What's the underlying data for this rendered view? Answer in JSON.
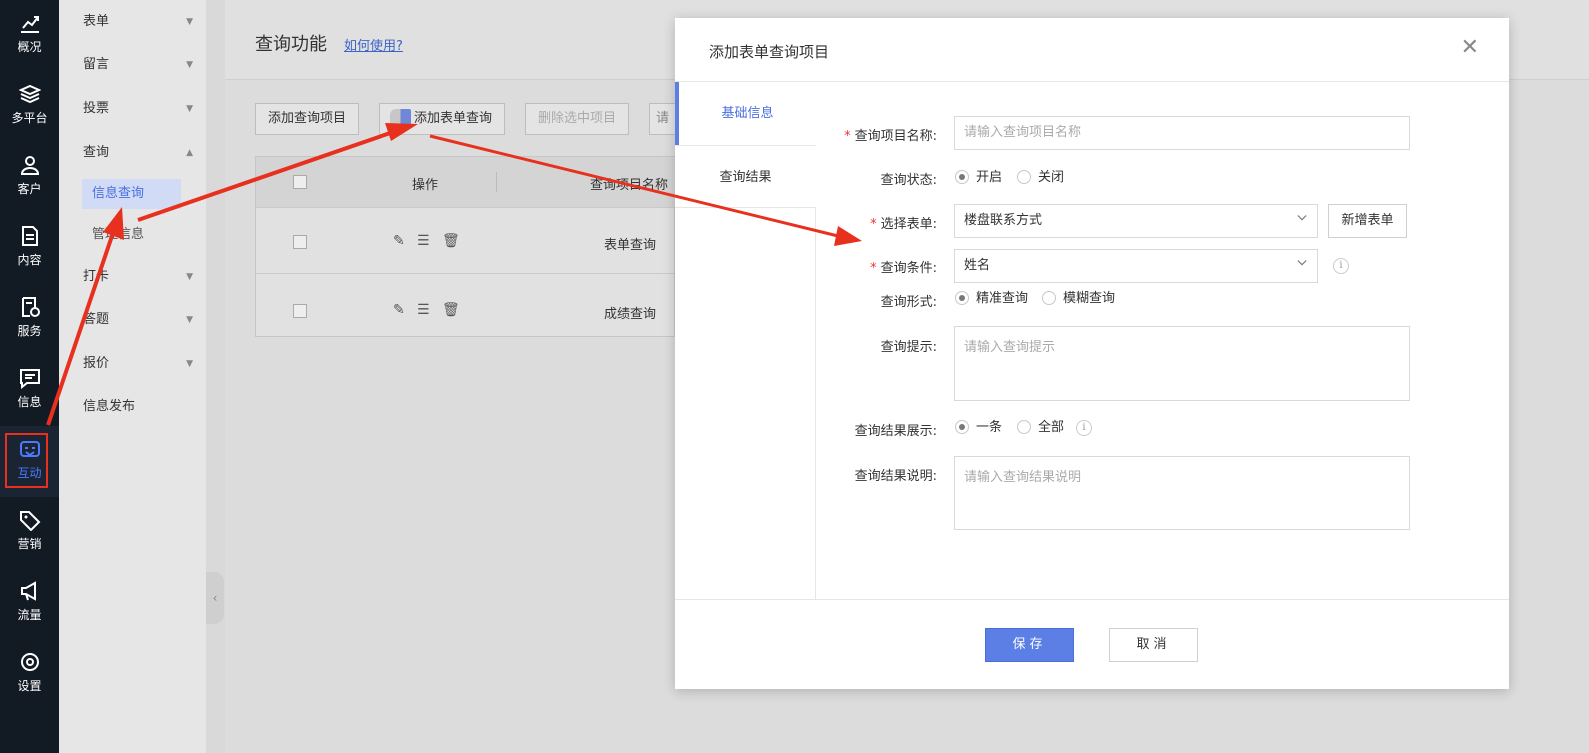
{
  "rail": {
    "items": [
      {
        "label": "概况",
        "icon": "chart-icon"
      },
      {
        "label": "多平台",
        "icon": "layers-icon"
      },
      {
        "label": "客户",
        "icon": "user-icon"
      },
      {
        "label": "内容",
        "icon": "document-icon"
      },
      {
        "label": "服务",
        "icon": "service-icon"
      },
      {
        "label": "信息",
        "icon": "message-icon"
      },
      {
        "label": "互动",
        "icon": "interaction-icon"
      },
      {
        "label": "营销",
        "icon": "tag-icon"
      },
      {
        "label": "流量",
        "icon": "megaphone-icon"
      },
      {
        "label": "设置",
        "icon": "settings-icon"
      }
    ],
    "active_index": 6
  },
  "sidebar": {
    "items": [
      {
        "label": "表单"
      },
      {
        "label": "留言"
      },
      {
        "label": "投票"
      },
      {
        "label": "查询"
      },
      {
        "label": "打卡"
      },
      {
        "label": "答题"
      },
      {
        "label": "报价"
      },
      {
        "label": "信息发布"
      }
    ],
    "sub_items": [
      {
        "label": "信息查询",
        "active": true
      },
      {
        "label": "管理信息",
        "active": false
      }
    ]
  },
  "main": {
    "title": "查询功能",
    "howto_link": "如何使用?",
    "toolbar": {
      "add_item": "添加查询项目",
      "add_form_query": "添加表单查询",
      "delete_selected": "删除选中项目",
      "search_hint": "请输"
    },
    "table": {
      "headers": {
        "op": "操作",
        "name": "查询项目名称"
      },
      "rows": [
        {
          "name": "表单查询"
        },
        {
          "name": "成绩查询"
        }
      ]
    }
  },
  "modal": {
    "title": "添加表单查询项目",
    "tabs": [
      "基础信息",
      "查询结果"
    ],
    "fields": {
      "name_label": "查询项目名称:",
      "name_placeholder": "请输入查询项目名称",
      "status_label": "查询状态:",
      "status_on": "开启",
      "status_off": "关闭",
      "form_label": "选择表单:",
      "form_value": "楼盘联系方式",
      "new_form_button": "新增表单",
      "condition_label": "查询条件:",
      "condition_value": "姓名",
      "mode_label": "查询形式:",
      "mode_exact": "精准查询",
      "mode_fuzzy": "模糊查询",
      "hint_label": "查询提示:",
      "hint_placeholder": "请输入查询提示",
      "display_label": "查询结果展示:",
      "display_one": "一条",
      "display_all": "全部",
      "desc_label": "查询结果说明:",
      "desc_placeholder": "请输入查询结果说明"
    },
    "save_button": "保存",
    "cancel_button": "取消"
  },
  "colors": {
    "accent": "#5b7fe5",
    "annotation_red": "#e8301e",
    "rail_bg": "#121a24"
  }
}
